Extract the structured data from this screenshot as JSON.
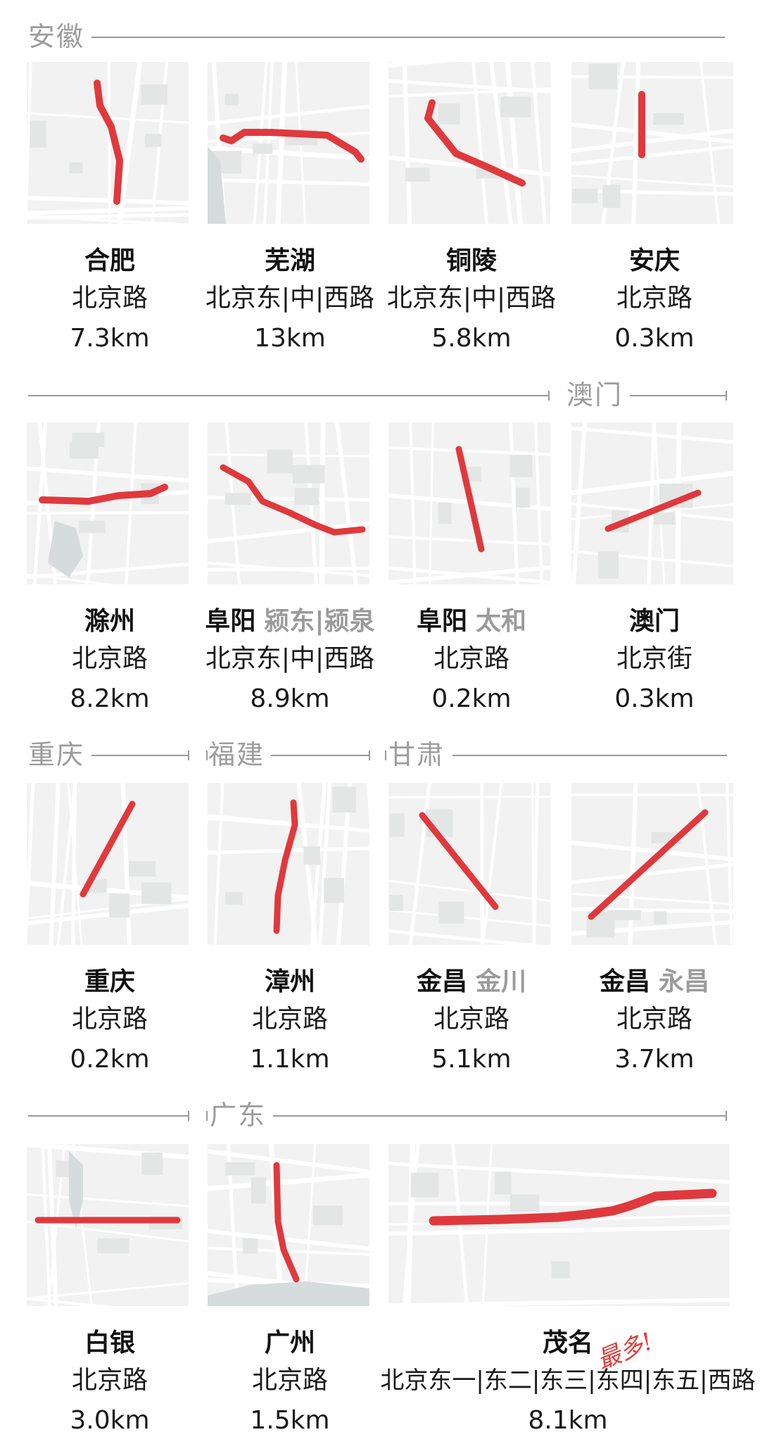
{
  "colors": {
    "route": "#e0393d",
    "map_bg": "#f1f2f1",
    "rule": "#9a9a9a",
    "label": "#9c9c9c"
  },
  "sections": {
    "anhui": "安徽",
    "macau": "澳门",
    "chongqing": "重庆",
    "fujian": "福建",
    "gansu": "甘肃",
    "guangdong": "广东"
  },
  "cards": [
    {
      "city": "合肥",
      "sub": "",
      "road": "北京路",
      "length": "7.3km"
    },
    {
      "city": "芜湖",
      "sub": "",
      "road": "北京东|中|西路",
      "length": "13km"
    },
    {
      "city": "铜陵",
      "sub": "",
      "road": "北京东|中|西路",
      "length": "5.8km"
    },
    {
      "city": "安庆",
      "sub": "",
      "road": "北京路",
      "length": "0.3km"
    },
    {
      "city": "滁州",
      "sub": "",
      "road": "北京路",
      "length": "8.2km"
    },
    {
      "city": "阜阳",
      "sub": "颍东|颍泉",
      "road": "北京东|中|西路",
      "length": "8.9km"
    },
    {
      "city": "阜阳",
      "sub": "太和",
      "road": "北京路",
      "length": "0.2km"
    },
    {
      "city": "澳门",
      "sub": "",
      "road": "北京街",
      "length": "0.3km"
    },
    {
      "city": "重庆",
      "sub": "",
      "road": "北京路",
      "length": "0.2km"
    },
    {
      "city": "漳州",
      "sub": "",
      "road": "北京路",
      "length": "1.1km"
    },
    {
      "city": "金昌",
      "sub": "金川",
      "road": "北京路",
      "length": "5.1km"
    },
    {
      "city": "金昌",
      "sub": "永昌",
      "road": "北京路",
      "length": "3.7km"
    },
    {
      "city": "白银",
      "sub": "",
      "road": "北京路",
      "length": "3.0km"
    },
    {
      "city": "广州",
      "sub": "",
      "road": "北京路",
      "length": "1.5km"
    },
    {
      "city": "茂名",
      "sub": "",
      "road": "北京东一|东二|东三|东四|东五|西路",
      "length": "8.1km"
    }
  ],
  "maoming_note": "最多!"
}
